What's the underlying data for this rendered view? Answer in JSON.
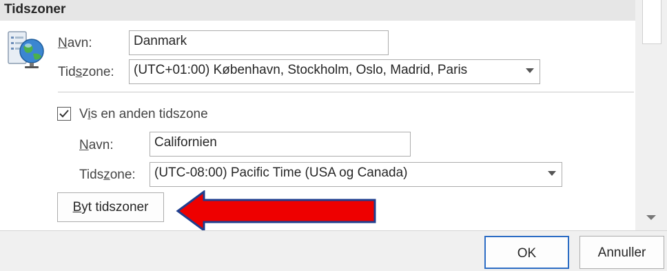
{
  "section": {
    "title": "Tidszoner"
  },
  "primary": {
    "name_label_accel": "N",
    "name_label_rest": "avn:",
    "name_value": "Danmark",
    "zone_label_pre": "Tid",
    "zone_label_accel": "s",
    "zone_label_post": "zone:",
    "zone_value": "(UTC+01:00) København, Stockholm, Oslo, Madrid, Paris"
  },
  "secondary": {
    "checkbox_checked": true,
    "checkbox_label_pre": "V",
    "checkbox_label_accel": "i",
    "checkbox_label_post": "s en anden tidszone",
    "name_label_accel": "N",
    "name_label_rest": "avn:",
    "name_value": "Californien",
    "zone_label_pre": "Tids",
    "zone_label_accel": "z",
    "zone_label_post": "one:",
    "zone_value": "(UTC-08:00) Pacific Time (USA og Canada)"
  },
  "swap_button": {
    "accel": "B",
    "rest": "yt tidszoner"
  },
  "dialog_buttons": {
    "ok": "OK",
    "cancel": "Annuller"
  },
  "colors": {
    "arrow_fill": "#ee0000",
    "arrow_outline": "#1f3f8f",
    "ok_border": "#2b6cc4"
  },
  "icons": {
    "section_icon": "globe-computer-icon",
    "annotation": "red-arrow-icon"
  }
}
